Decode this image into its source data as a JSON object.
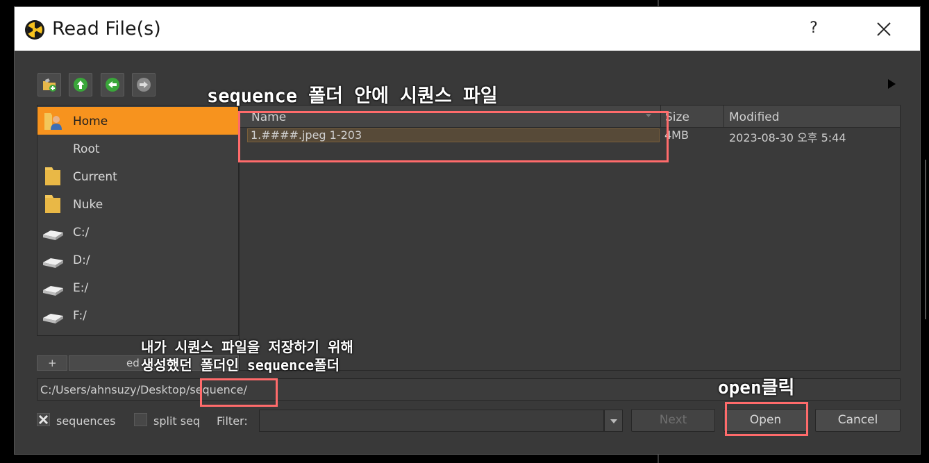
{
  "window": {
    "title": "Read File(s)",
    "help_label": "?"
  },
  "toolbar": {
    "icons": [
      "new-folder-icon",
      "up-arrow-icon",
      "back-arrow-icon",
      "forward-arrow-icon"
    ]
  },
  "sidebar": {
    "items": [
      {
        "label": "Home",
        "icon": "user-home-icon",
        "active": true
      },
      {
        "label": "Root",
        "icon": "",
        "active": false
      },
      {
        "label": "Current",
        "icon": "folder-icon",
        "active": false
      },
      {
        "label": "Nuke",
        "icon": "folder-icon",
        "active": false
      },
      {
        "label": "C:/",
        "icon": "drive-icon",
        "active": false
      },
      {
        "label": "D:/",
        "icon": "drive-icon",
        "active": false
      },
      {
        "label": "E:/",
        "icon": "drive-icon",
        "active": false
      },
      {
        "label": "F:/",
        "icon": "drive-icon",
        "active": false
      }
    ],
    "add_label": "+",
    "edit_label": "ed"
  },
  "filelist": {
    "columns": {
      "name": "Name",
      "size": "Size",
      "modified": "Modified"
    },
    "rows": [
      {
        "name": "1.####.jpeg 1-203",
        "size": "4MB",
        "modified": "2023-08-30 오후 5:44"
      }
    ]
  },
  "path": {
    "value": "C:/Users/ahnsuzy/Desktop/sequence/"
  },
  "options": {
    "sequences_label": "sequences",
    "sequences_checked": true,
    "split_seq_label": "split seq",
    "split_seq_checked": false,
    "filter_label": "Filter:",
    "filter_value": ""
  },
  "buttons": {
    "next": "Next",
    "open": "Open",
    "cancel": "Cancel"
  },
  "annotations": {
    "top": "sequence 폴더 안에 시퀀스 파일",
    "bottom_line1": "내가 시퀀스 파일을 저장하기 위해",
    "bottom_line2": "생성했던 폴더인 sequence폴더",
    "open": "open클릭"
  },
  "colors": {
    "accent": "#f7931e",
    "annotation_box": "#ff6b6b",
    "panel": "#393939"
  }
}
